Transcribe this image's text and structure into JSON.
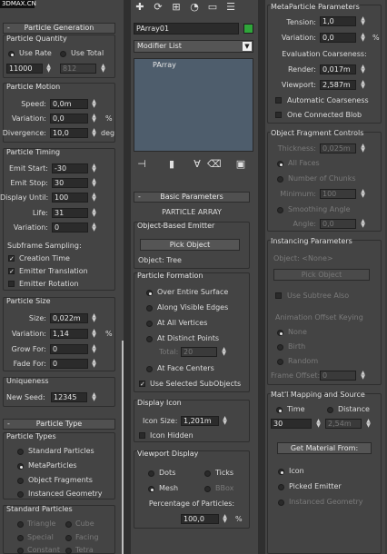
{
  "watermark": "3DMAX.CN",
  "left": {
    "rollout_title": "Particle Generation",
    "pm_minus": "-",
    "quantity": {
      "title": "Particle Quantity",
      "use_rate": "Use Rate",
      "use_total": "Use Total",
      "rate_value": "11000",
      "total_value": "812"
    },
    "motion": {
      "title": "Particle Motion",
      "speed_label": "Speed:",
      "speed_value": "0,0m",
      "variation_label": "Variation:",
      "variation_value": "0,0",
      "percent": "%",
      "divergence_label": "Divergence:",
      "divergence_value": "10,0",
      "deg": "deg"
    },
    "timing": {
      "title": "Particle Timing",
      "emit_start_label": "Emit Start:",
      "emit_start_value": "-30",
      "emit_stop_label": "Emit Stop:",
      "emit_stop_value": "30",
      "display_until_label": "Display Until:",
      "display_until_value": "100",
      "life_label": "Life:",
      "life_value": "31",
      "variation_label": "Variation:",
      "variation_value": "0",
      "subframe_title": "Subframe Sampling:",
      "creation_time": "Creation Time",
      "emitter_translation": "Emitter Translation",
      "emitter_rotation": "Emitter Rotation"
    },
    "size": {
      "title": "Particle Size",
      "size_label": "Size:",
      "size_value": "0,022m",
      "variation_label": "Variation:",
      "variation_value": "1,14",
      "percent": "%",
      "grow_label": "Grow For:",
      "grow_value": "0",
      "fade_label": "Fade For:",
      "fade_value": "0"
    },
    "uniqueness": {
      "title": "Uniqueness",
      "seed_label": "New Seed:",
      "seed_value": "12345"
    },
    "type_rollout_title": "Particle Type",
    "types": {
      "title": "Particle Types",
      "standard": "Standard Particles",
      "meta": "MetaParticles",
      "fragments": "Object Fragments",
      "instanced": "Instanced Geometry"
    },
    "standard": {
      "title": "Standard Particles",
      "triangle": "Triangle",
      "cube": "Cube",
      "special": "Special",
      "facing": "Facing",
      "constant": "Constant",
      "tetra": "Tetra"
    }
  },
  "middle": {
    "object_name": "PArray01",
    "color_swatch": "#2fa63a",
    "modifier_list": "Modifier List",
    "stack_item": "PArray",
    "basic_rollout_title": "Basic Parameters",
    "particle_array": "PARTICLE ARRAY",
    "emitter_title": "Object-Based Emitter",
    "pick_object": "Pick Object",
    "object_label": "Object: Tree",
    "formation": {
      "title": "Particle Formation",
      "surface": "Over Entire Surface",
      "edges": "Along Visible Edges",
      "vertices": "At All Vertices",
      "distinct": "At Distinct Points",
      "total_label": "Total:",
      "total_value": "20",
      "centers": "At Face Centers",
      "use_selected": "Use Selected SubObjects"
    },
    "display_icon": {
      "title": "Display Icon",
      "size_label": "Icon Size:",
      "size_value": "1,201m",
      "hidden": "Icon Hidden"
    },
    "viewport": {
      "title": "Viewport Display",
      "dots": "Dots",
      "ticks": "Ticks",
      "mesh": "Mesh",
      "bbox": "BBox",
      "percent_title": "Percentage of Particles:",
      "percent_value": "100,0",
      "percent": "%"
    }
  },
  "right": {
    "meta": {
      "title": "MetaParticle Parameters",
      "tension_label": "Tension:",
      "tension_value": "1,0",
      "variation_label": "Variation:",
      "variation_value": "0,0",
      "percent": "%",
      "eval_title": "Evaluation Coarseness:",
      "render_label": "Render:",
      "render_value": "0,017m",
      "viewport_label": "Viewport:",
      "viewport_value": "2,587m",
      "auto": "Automatic Coarseness",
      "one_blob": "One Connected Blob"
    },
    "fragment": {
      "title": "Object Fragment Controls",
      "thickness_label": "Thickness:",
      "thickness_value": "0,025m",
      "all_faces": "All Faces",
      "chunks": "Number of Chunks",
      "minimum_label": "Minimum:",
      "minimum_value": "100",
      "smoothing": "Smoothing Angle",
      "angle_label": "Angle:",
      "angle_value": "0,0"
    },
    "instancing": {
      "title": "Instancing Parameters",
      "object_label": "Object: <None>",
      "pick_object": "Pick Object",
      "subtree": "Use Subtree Also",
      "anim_title": "Animation Offset Keying",
      "none": "None",
      "birth": "Birth",
      "random": "Random",
      "frame_offset_label": "Frame Offset:",
      "frame_offset_value": "0"
    },
    "mapping": {
      "title": "Mat'l Mapping and Source",
      "time": "Time",
      "distance": "Distance",
      "time_value": "30",
      "distance_value": "2,54m",
      "get_material": "Get Material From:",
      "icon": "Icon",
      "picked_emitter": "Picked Emitter",
      "instanced_geometry": "Instanced Geometry"
    }
  }
}
